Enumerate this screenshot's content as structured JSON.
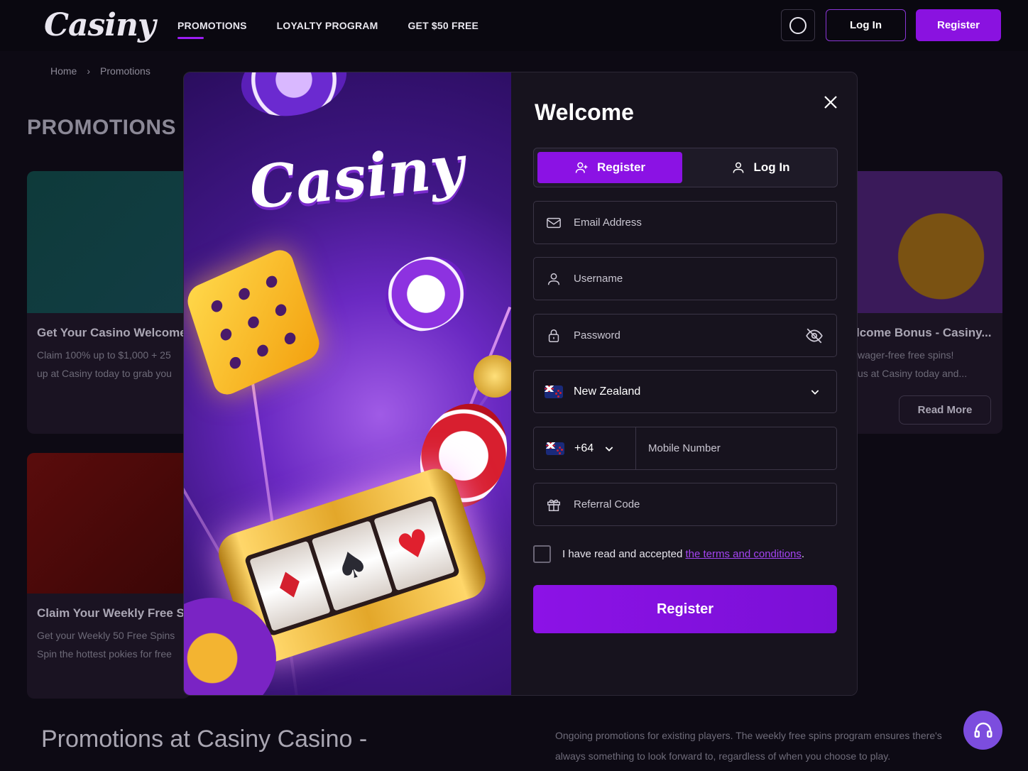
{
  "header": {
    "logo": "Casiny",
    "nav": [
      "PROMOTIONS",
      "LOYALTY PROGRAM",
      "GET $50 FREE"
    ],
    "login_label": "Log In",
    "register_label": "Register"
  },
  "breadcrumb": {
    "home": "Home",
    "separator": "›",
    "current": "Promotions"
  },
  "page_title": "PROMOTIONS",
  "cards": [
    {
      "title": "Get Your Casino Welcome",
      "lines": [
        "Claim 100% up to $1,000 + 25",
        "up at Casiny today to grab you"
      ]
    },
    {
      "title": "Claim Your Weekly Free Sp",
      "lines": [
        "Get your Weekly 50 Free Spins",
        "Spin the hottest pokies for free"
      ]
    },
    {
      "title": "lcome Bonus - Casiny...",
      "lines": [
        "wager-free free spins!",
        "us at Casiny today and..."
      ],
      "button": "Read More"
    }
  ],
  "bottom": {
    "title": "Promotions at Casiny Casino -",
    "text": "Ongoing promotions for existing players. The weekly free spins program ensures there's always something to look forward to, regardless of when you choose to play."
  },
  "modal": {
    "art_logo": "Casiny",
    "title": "Welcome",
    "tabs": {
      "register": "Register",
      "login": "Log In"
    },
    "fields": {
      "email_placeholder": "Email Address",
      "username_placeholder": "Username",
      "password_placeholder": "Password",
      "country": "New Zealand",
      "phone_code": "+64",
      "mobile_placeholder": "Mobile Number",
      "referral_placeholder": "Referral Code"
    },
    "terms": {
      "prefix": "I have read and accepted ",
      "link": "the terms and conditions",
      "suffix": "."
    },
    "submit": "Register"
  },
  "colors": {
    "accent": "#8b12e4",
    "link": "#a444f2",
    "background": "#0d0a14"
  }
}
